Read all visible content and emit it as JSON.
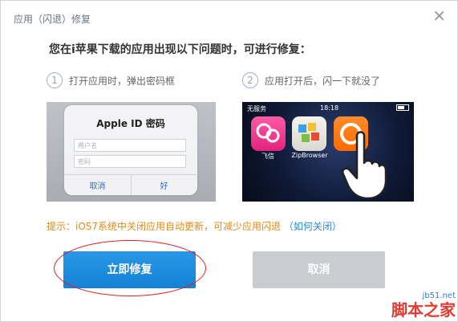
{
  "dialog": {
    "title": "应用（闪退）修复",
    "close_label": "×",
    "headline": "您在i苹果下载的应用出现以下问题时，可进行修复："
  },
  "issues": [
    {
      "num": "1",
      "text": "打开应用时，弹出密码框"
    },
    {
      "num": "2",
      "text": "应用打开后，闪一下就没了"
    }
  ],
  "example1": {
    "alert_title": "Apple ID 密码",
    "username_placeholder": "用户名",
    "password_placeholder": "密码",
    "cancel": "取消",
    "ok": "好"
  },
  "example2": {
    "carrier": "无服务",
    "time": "18:18",
    "apps": [
      "飞信",
      "ZipBrowser",
      ""
    ]
  },
  "tip": {
    "text": "提示：iOS7系统中关闭应用自动更新，可减少应用闪退",
    "link": "（如何关闭）"
  },
  "buttons": {
    "repair": "立即修复",
    "cancel": "取消"
  },
  "watermark": {
    "site": "jb51.net",
    "brand": "脚本之家"
  },
  "colors": {
    "primary": "#1b8be0",
    "disabled": "#c9ccd1",
    "tip": "#e08a16",
    "link": "#2b86d9",
    "highlight": "#e02020"
  }
}
